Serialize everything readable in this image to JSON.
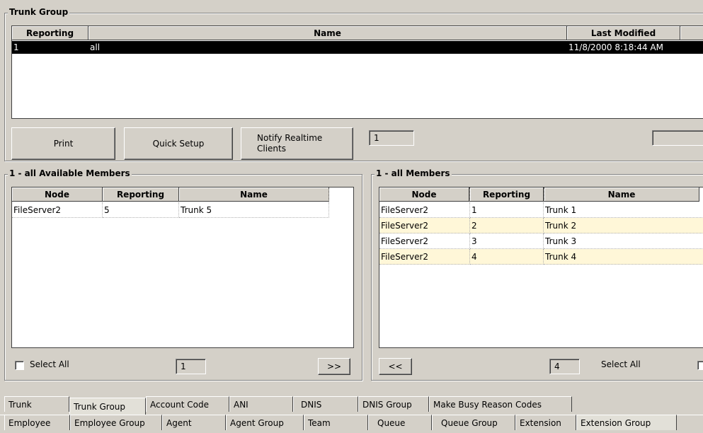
{
  "trunk_group": {
    "title": "Trunk Group",
    "columns": [
      "Reporting",
      "Name",
      "Last Modified"
    ],
    "rows": [
      {
        "reporting": "1",
        "name": "all",
        "last_modified": "11/8/2000 8:18:44 AM"
      }
    ],
    "buttons": {
      "print": "Print",
      "quick_setup": "Quick Setup",
      "notify": "Notify Realtime Clients"
    },
    "page_value": "1",
    "count_value": "1"
  },
  "available": {
    "title": "1 - all Available Members",
    "columns": [
      "Node",
      "Reporting",
      "Name"
    ],
    "rows": [
      {
        "node": "FileServer2",
        "reporting": "5",
        "name": "Trunk 5"
      }
    ],
    "select_all": "Select All",
    "count_value": "1",
    "move_right": ">>"
  },
  "members": {
    "title": "1 - all Members",
    "columns": [
      "Node",
      "Reporting",
      "Name"
    ],
    "rows": [
      {
        "node": "FileServer2",
        "reporting": "1",
        "name": "Trunk 1"
      },
      {
        "node": "FileServer2",
        "reporting": "2",
        "name": "Trunk 2"
      },
      {
        "node": "FileServer2",
        "reporting": "3",
        "name": "Trunk 3"
      },
      {
        "node": "FileServer2",
        "reporting": "4",
        "name": "Trunk 4"
      }
    ],
    "move_left": "<<",
    "count_value": "4",
    "select_all": "Select All"
  },
  "tabs_row1": [
    "Trunk",
    "Trunk Group",
    "Account Code",
    "ANI",
    "DNIS",
    "DNIS Group",
    "Make Busy Reason Codes"
  ],
  "tabs_row2": [
    "Employee",
    "Employee Group",
    "Agent",
    "Agent Group",
    "Team",
    "Queue",
    "Queue Group",
    "Extension",
    "Extension Group"
  ],
  "active_tab": "Trunk Group"
}
